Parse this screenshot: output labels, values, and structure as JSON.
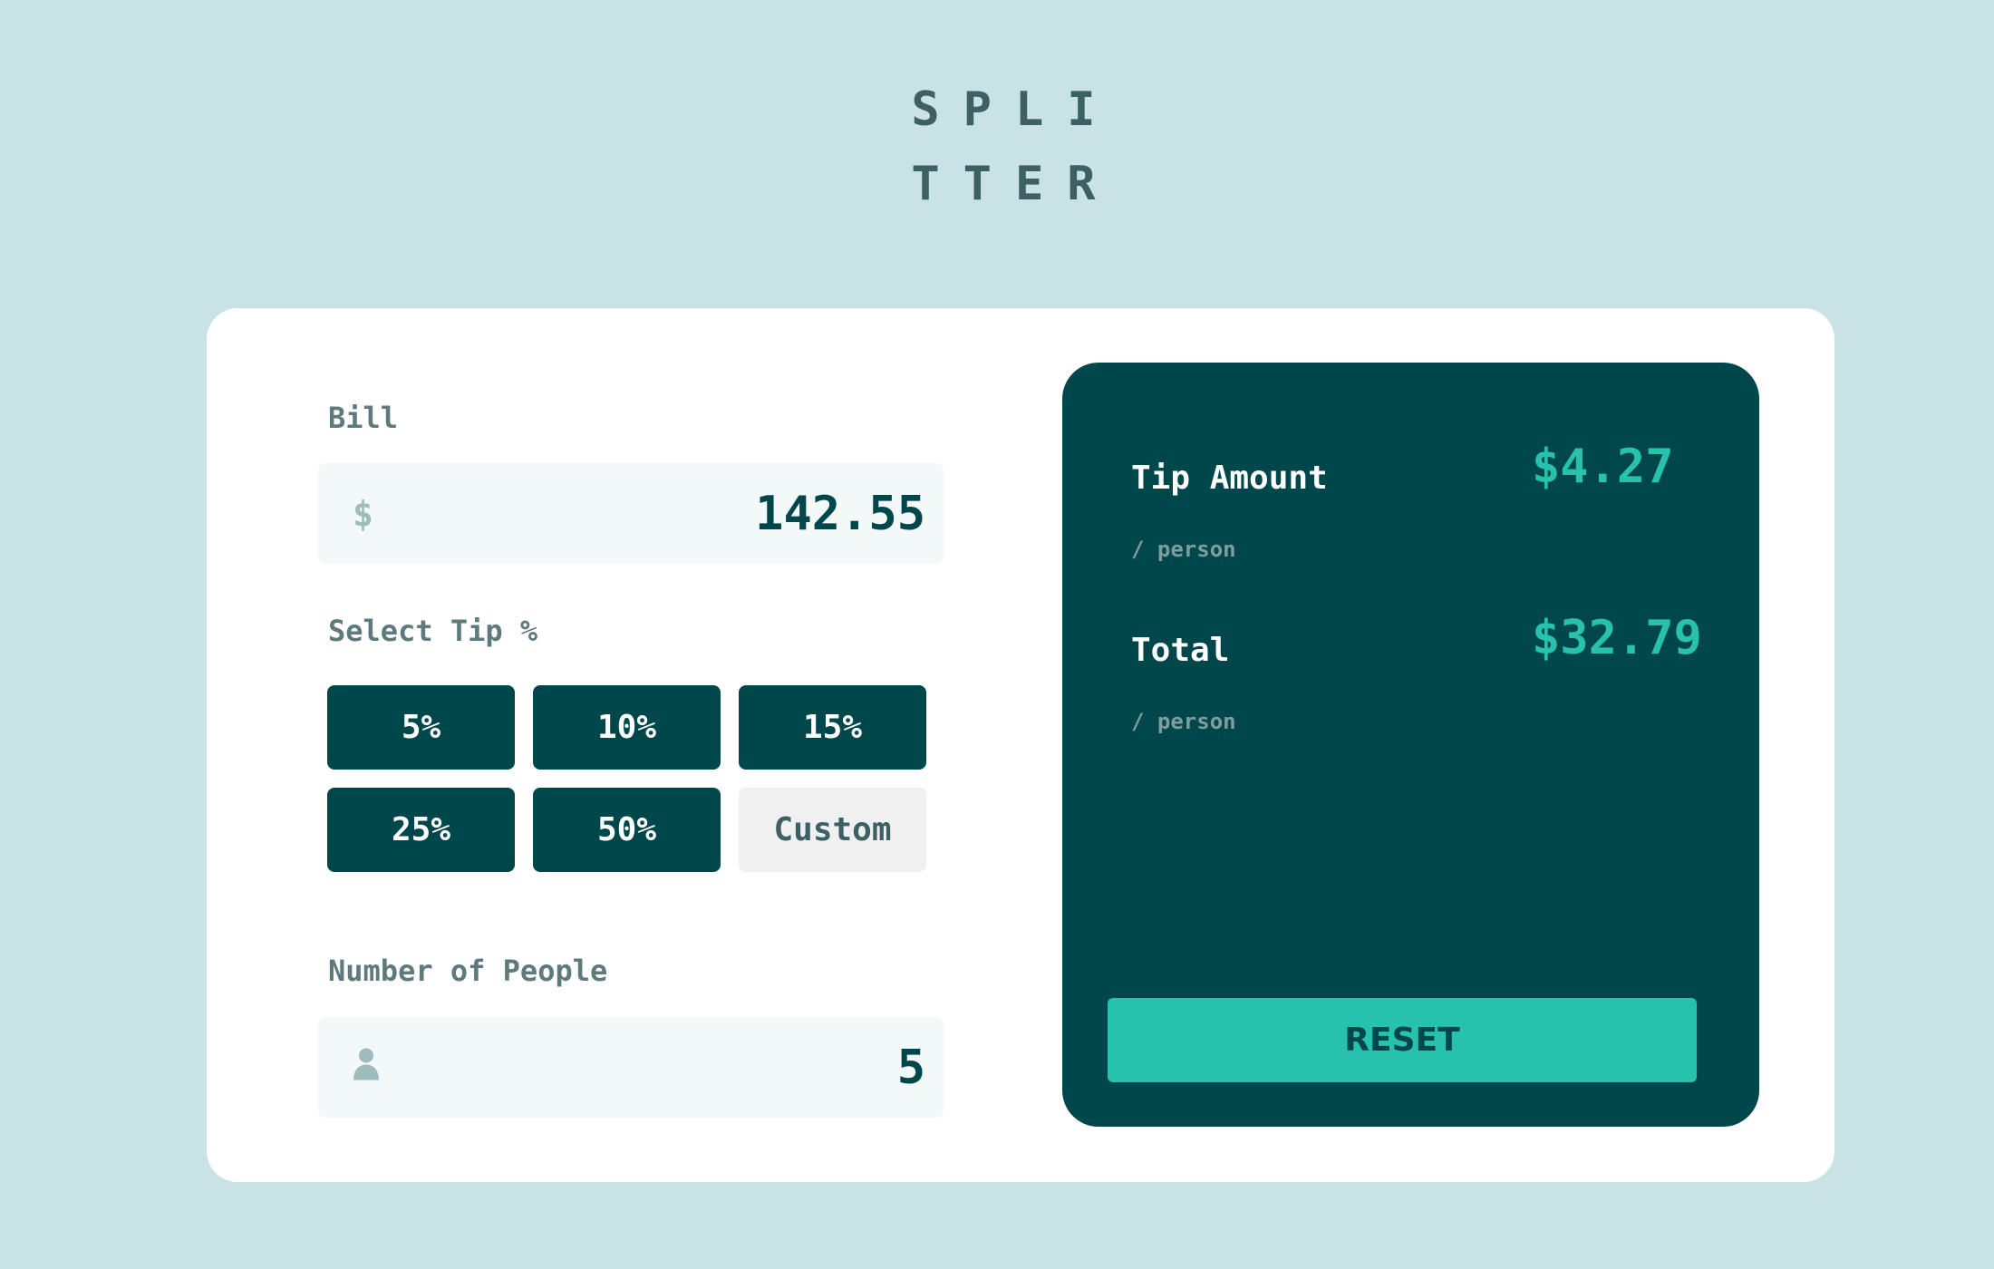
{
  "app": {
    "logo_line1": "SPLI",
    "logo_line2": "TTER"
  },
  "bill": {
    "label": "Bill",
    "currency_icon": "$",
    "value": "142.55"
  },
  "tip": {
    "label": "Select Tip %",
    "options": [
      "5%",
      "10%",
      "15%",
      "25%",
      "50%"
    ],
    "custom_label": "Custom"
  },
  "people": {
    "label": "Number of People",
    "icon": "person-icon",
    "value": "5"
  },
  "results": {
    "tip_amount_label": "Tip Amount",
    "tip_amount_sub": "/ person",
    "tip_amount_value": "$4.27",
    "total_label": "Total",
    "total_sub": "/ person",
    "total_value": "$32.79",
    "reset_label": "RESET"
  },
  "colors": {
    "background": "#c9e2e6",
    "card": "#ffffff",
    "dark_teal": "#00474b",
    "accent": "#26c2ae",
    "muted": "#5e7a7d"
  }
}
